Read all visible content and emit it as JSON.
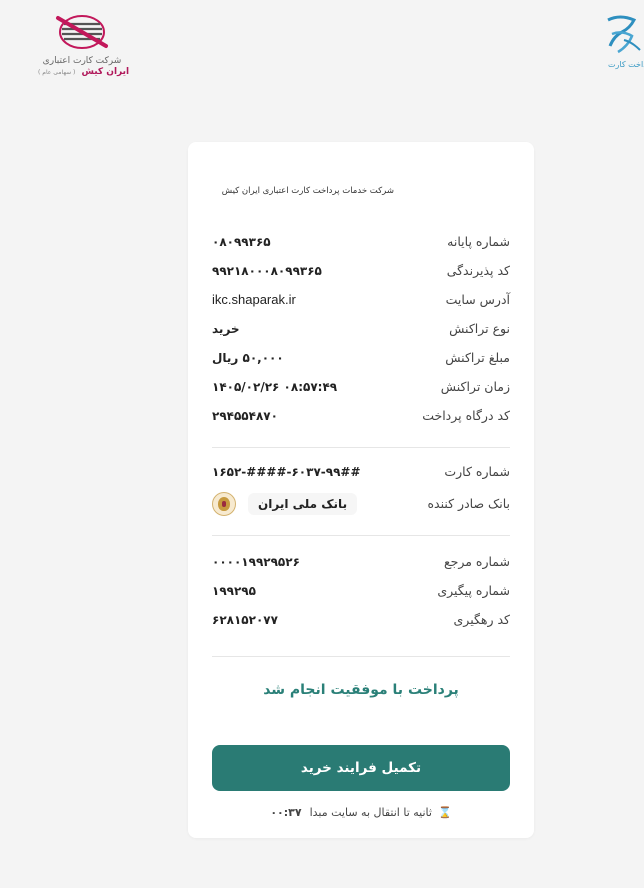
{
  "header": {
    "ikc_logo": {
      "icon": "iran-kish-logo",
      "line1": "شرکت کارت اعتباری",
      "line2": "ایران کیش",
      "line2_sub": "( سهامی عام )"
    },
    "shaparak_logo": {
      "icon": "shaparak-logo",
      "text": "پرداخت کارت"
    }
  },
  "receipt": {
    "title": "شرکت خدمات پرداخت کارت اعتباری ایران کیش",
    "rows": [
      {
        "label": "شماره پایانه",
        "value": "۰۸۰۹۹۳۶۵"
      },
      {
        "label": "کد پذیرندگی",
        "value": "۹۹۲۱۸۰۰۰۸۰۹۹۳۶۵"
      },
      {
        "label": "آدرس سایت",
        "value": "ikc.shaparak.ir"
      },
      {
        "label": "نوع تراکنش",
        "value": "خرید"
      },
      {
        "label": "مبلغ تراکنش",
        "value": "۵۰,۰۰۰ ریال"
      },
      {
        "label": "زمان تراکنش",
        "value": "۰۸:۵۷:۴۹ ۱۴۰۵/۰۲/۲۶"
      },
      {
        "label": "کد درگاه پرداخت",
        "value": "۲۹۴۵۵۴۸۷۰"
      }
    ],
    "card_rows": [
      {
        "label": "شماره کارت",
        "value": "۶۰۳۷-۹۹##-####-۱۶۵۲"
      },
      {
        "label": "بانک صادر کننده",
        "value": "بانک ملی ایران",
        "icon": "bank-melli-logo"
      }
    ],
    "ref_rows": [
      {
        "label": "شماره مرجع",
        "value": "۰۰۰۰۱۹۹۲۹۵۲۶"
      },
      {
        "label": "شماره پیگیری",
        "value": "۱۹۹۲۹۵"
      },
      {
        "label": "کد رهگیری",
        "value": "۶۲۸۱۵۲۰۷۷"
      }
    ],
    "success_message": "پرداخت با موفقیت انجام شد",
    "complete_button": "تکمیل فرایند خرید",
    "timer": {
      "icon": "hourglass-icon",
      "text": "ثانیه تا انتقال به سایت مبدا",
      "count": "۰۰:۳۷"
    }
  },
  "colors": {
    "accent": "#2a7b74",
    "success_text": "#2a8078",
    "background": "#f4f4f4",
    "card": "#ffffff"
  }
}
